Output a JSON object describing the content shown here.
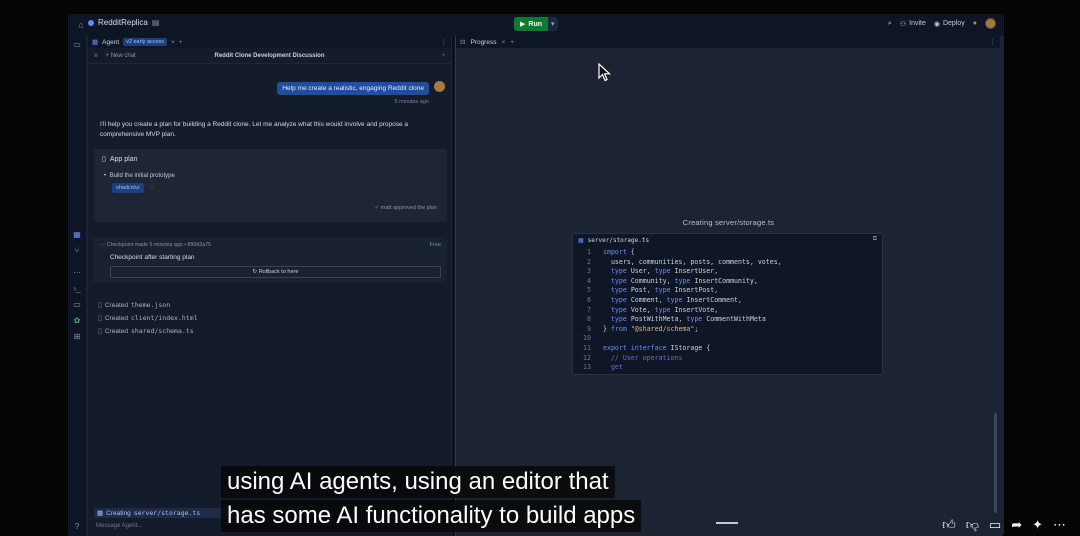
{
  "topbar": {
    "repl_name": "RedditReplica",
    "run_label": "Run",
    "invite_label": "Invite",
    "deploy_label": "Deploy"
  },
  "agent": {
    "tab_label": "Agent",
    "tab_badge": "v2 early access",
    "new_chat_label": "New chat",
    "conversation_title": "Reddit Clone Development Discussion",
    "user_message": "Help me create a realistic, engaging Reddit clone",
    "message_time": "5 minutes ago",
    "reply": "I'll help you create a plan for building a Reddit clone. Let me analyze what this would involve and propose a comprehensive MVP plan.",
    "plan": {
      "title": "App plan",
      "item": "Build the initial prototype",
      "tag": "shadcn/ui",
      "approved": "matt approved the plan"
    },
    "checkpoint": {
      "meta": "Checkpoint made 5 minutes ago • 890d2a75",
      "free": "Free",
      "title": "Checkpoint after starting plan",
      "rollback": "Rollback to here"
    },
    "created_files": [
      {
        "label": "Created",
        "file": "theme.json"
      },
      {
        "label": "Created",
        "file": "client/index.html"
      },
      {
        "label": "Created",
        "file": "shared/schema.ts"
      }
    ],
    "status_label": "Creating",
    "status_file": "server/storage.ts",
    "input_placeholder": "Message Agent..."
  },
  "progress": {
    "tab_label": "Progress",
    "creating_label": "Creating server/storage.ts",
    "code_file": "server/storage.ts"
  },
  "captions": {
    "line1": "using AI agents, using an editor that",
    "line2": "has some AI functionality to build apps"
  },
  "colors": {
    "accent": "#1f4e9c",
    "run_green": "#0e7a2d",
    "keyword": "#6c8cf5",
    "string": "#e6b57a"
  }
}
